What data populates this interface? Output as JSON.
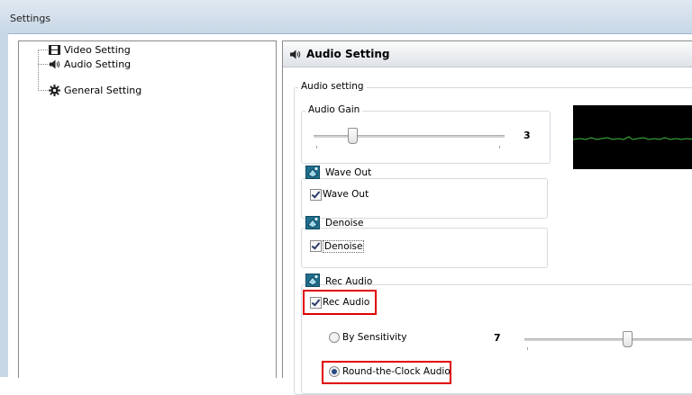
{
  "window": {
    "title": "Settings"
  },
  "tree": {
    "items": [
      {
        "label": "Video Setting",
        "icon": "film-icon"
      },
      {
        "label": "Audio Setting",
        "icon": "speaker-icon"
      },
      {
        "label": "General Setting",
        "icon": "gear-icon"
      }
    ]
  },
  "panel": {
    "header": "Audio Setting",
    "group_label": "Audio setting",
    "audio_gain": {
      "label": "Audio Gain",
      "value": "3",
      "level": 0.27
    },
    "wave_out": {
      "label": "Wave Out",
      "checkbox_label": "Wave Out",
      "checked": true
    },
    "denoise": {
      "label": "Denoise",
      "checkbox_label": "Denoise",
      "checked": true
    },
    "rec_audio": {
      "label": "Rec Audio",
      "checkbox_label": "Rec Audio",
      "checked": true,
      "by_sensitivity": {
        "label": "By Sensitivity",
        "value": "7",
        "selected": false
      },
      "round_the_clock": {
        "label": "Round-the-Clock Audio",
        "selected": true
      }
    }
  },
  "colors": {
    "highlight": "#e00000",
    "waveform_bg": "#000000",
    "waveform_line": "#3fbf3f"
  }
}
